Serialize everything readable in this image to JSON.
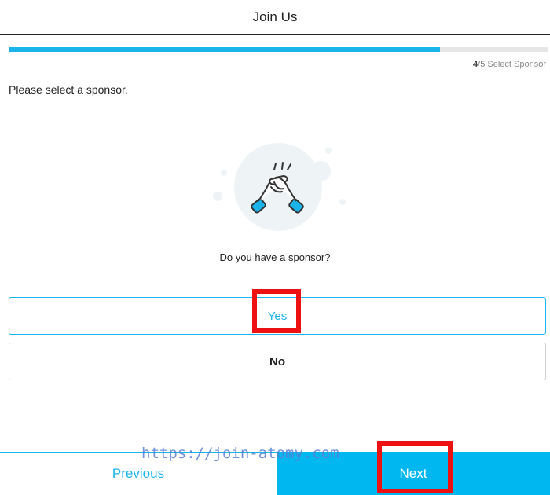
{
  "header": {
    "title": "Join Us"
  },
  "progress": {
    "fraction": 0.8
  },
  "step": {
    "current": "4",
    "total": "/5",
    "label": "Select Sponsor"
  },
  "prompt": "Please select a sponsor.",
  "illustration": {
    "icon": "handshake-icon"
  },
  "question": "Do you have a sponsor?",
  "options": {
    "yes": "Yes",
    "no": "No"
  },
  "footer": {
    "previous": "Previous",
    "next": "Next"
  },
  "watermark": "https://join-atomy.com",
  "colors": {
    "accent": "#1bb4ea",
    "next_bg": "#00b7ef",
    "highlight": "#ee1111"
  }
}
